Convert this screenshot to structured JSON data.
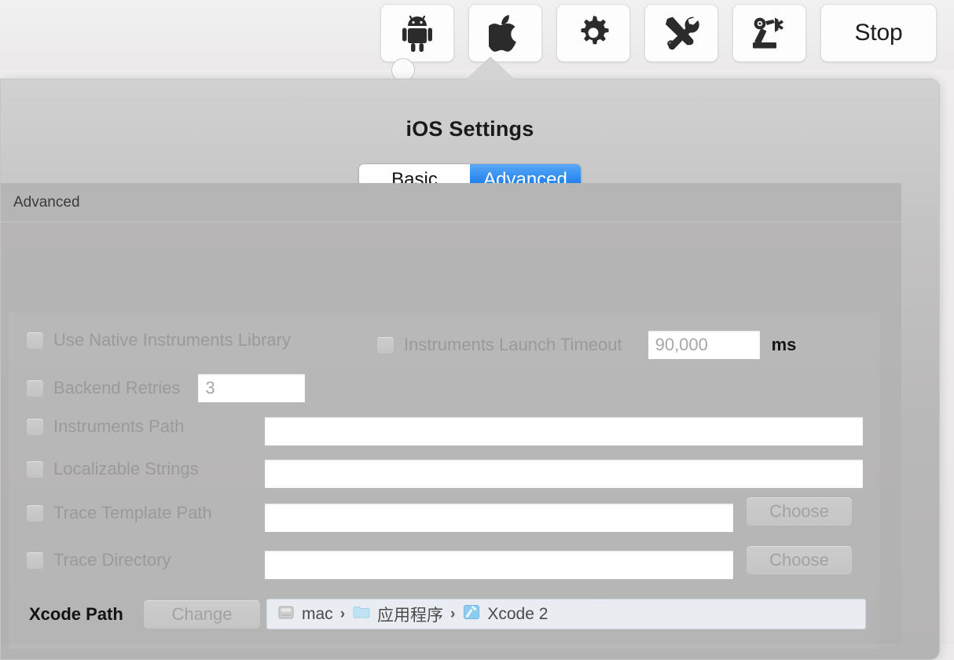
{
  "toolbar": {
    "buttons": [
      {
        "name": "android-icon",
        "label": "",
        "icon": "android"
      },
      {
        "name": "apple-icon",
        "label": "",
        "icon": "apple"
      },
      {
        "name": "gear-icon",
        "label": "",
        "icon": "gear"
      },
      {
        "name": "tools-icon",
        "label": "",
        "icon": "tools"
      },
      {
        "name": "robot-arm-icon",
        "label": "",
        "icon": "robot"
      },
      {
        "name": "stop-button",
        "label": "Stop",
        "icon": "text"
      }
    ],
    "stop_label": "Stop"
  },
  "popover": {
    "title": "iOS Settings",
    "tabs": [
      {
        "label": "Basic",
        "active": false
      },
      {
        "label": "Advanced",
        "active": true
      }
    ],
    "group_label": "Advanced"
  },
  "fields": {
    "use_native_instruments_library": {
      "label": "Use Native Instruments Library",
      "checked": false
    },
    "instruments_launch_timeout": {
      "label": "Instruments Launch Timeout",
      "checked": false,
      "value": "90,000",
      "unit": "ms"
    },
    "backend_retries": {
      "label": "Backend Retries",
      "checked": false,
      "value": "3"
    },
    "instruments_path": {
      "label": "Instruments Path",
      "checked": false,
      "value": ""
    },
    "localizable_strings": {
      "label": "Localizable Strings",
      "checked": false,
      "value": ""
    },
    "trace_template_path": {
      "label": "Trace Template Path",
      "checked": false,
      "value": "",
      "button_label": "Choose"
    },
    "trace_directory": {
      "label": "Trace Directory",
      "checked": false,
      "value": "",
      "button_label": "Choose"
    },
    "xcode_path": {
      "label": "Xcode Path",
      "button_label": "Change",
      "crumbs": [
        {
          "label": "mac",
          "icon": "drive"
        },
        {
          "label": "应用程序",
          "icon": "folder"
        },
        {
          "label": "Xcode 2",
          "icon": "xcode"
        }
      ],
      "separator": "›"
    }
  },
  "colors": {
    "accent_blue": "#2a86ee",
    "panel_gray": "#b6b5b5",
    "popover_gray": "#c3c2c2",
    "disabled_text": "#9b9a9a",
    "field_white": "#ffffff",
    "breadcrumb_bg": "#e9edf2"
  }
}
